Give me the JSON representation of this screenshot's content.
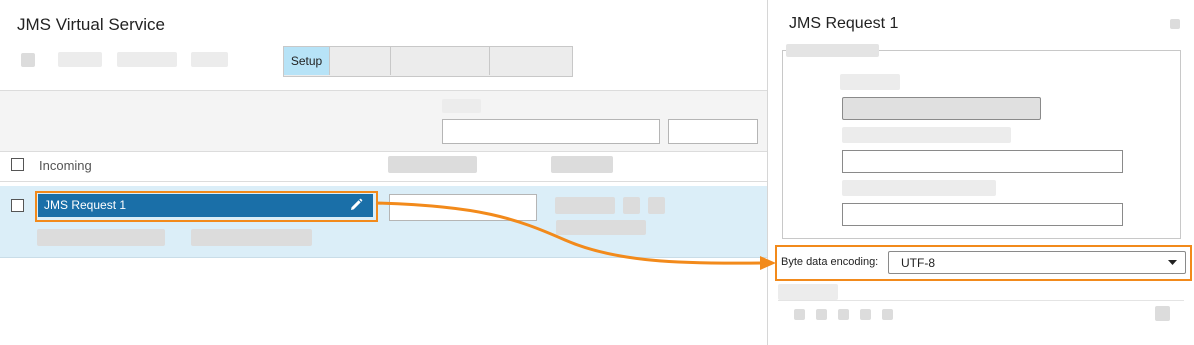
{
  "left_panel": {
    "title": "JMS Virtual Service",
    "tabs": [
      {
        "label": "Setup",
        "active": true
      },
      {
        "label": "",
        "active": false
      },
      {
        "label": "",
        "active": false
      },
      {
        "label": "",
        "active": false
      }
    ],
    "table": {
      "header_label": "Incoming",
      "row": {
        "name": "JMS Request 1",
        "edit_icon": "pencil-icon"
      }
    }
  },
  "right_panel": {
    "title": "JMS Request 1",
    "encoding": {
      "label": "Byte data encoding:",
      "value": "UTF-8",
      "dropdown_icon": "triangle-down-icon"
    }
  },
  "colors": {
    "accent": "#f28a1b",
    "selected_row": "#1a6fa8",
    "row_bg": "#dbeef8",
    "active_tab": "#b7e3f7"
  }
}
